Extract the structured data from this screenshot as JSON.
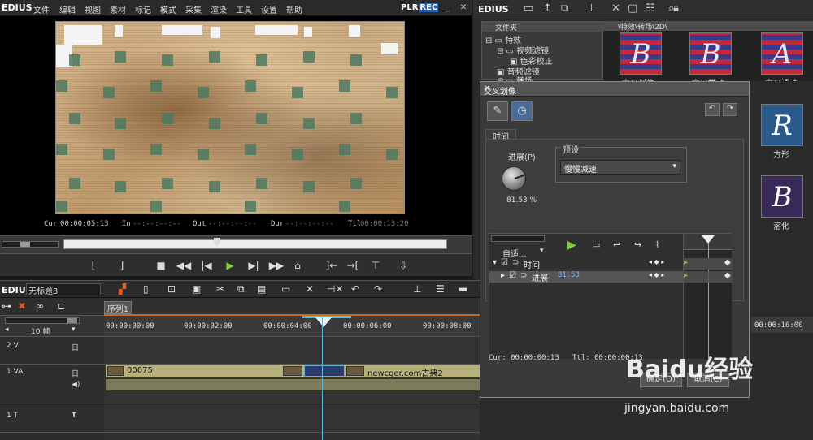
{
  "menu": {
    "logo": "EDIUS",
    "items": [
      "文件",
      "编辑",
      "视图",
      "素材",
      "标记",
      "模式",
      "采集",
      "渲染",
      "工具",
      "设置",
      "帮助"
    ],
    "plr": "PLR",
    "rec": "REC"
  },
  "timecodes": {
    "cur_label": "Cur",
    "cur": "00:00:05:13",
    "in_label": "In",
    "in": "--:--:--:--",
    "out_label": "Out",
    "out": "--:--:--:--",
    "dur_label": "Dur",
    "dur": "--:--:--:--",
    "ttl_label": "Ttl",
    "ttl": "00:00:13:20"
  },
  "bin": {
    "logo": "EDIUS",
    "tree_header": "文件夹",
    "path": "\\特效\\转场\\2D\\",
    "tree": [
      "特效",
      "视频滤镜",
      "色彩校正",
      "音频滤镜",
      "转场"
    ],
    "thumbs": [
      {
        "letter": "B",
        "label": "交叉划像"
      },
      {
        "letter": "B",
        "label": "交叉推动"
      },
      {
        "letter": "A",
        "label": "交叉滑动"
      },
      {
        "letter": "R",
        "label": "方形"
      },
      {
        "letter": "B",
        "label": "溶化"
      }
    ]
  },
  "dialog": {
    "title": "交叉划像",
    "tab": "时间",
    "progress_label": "进展(P)",
    "progress_value": "81.53 %",
    "preset_label": "预设",
    "preset_value": "慢慢减速",
    "auto_label": "自适...",
    "rows": [
      {
        "label": "时间"
      },
      {
        "label": "进展",
        "value": "81.53"
      }
    ],
    "cur_label": "Cur:",
    "cur": "00:00:00:13",
    "ttl_label": "Ttl:",
    "ttl": "00:00:00:13",
    "ok": "确定(O)",
    "cancel": "取消(C)"
  },
  "timeline": {
    "logo": "EDIUS",
    "project": "无标题3",
    "sequence_tab": "序列1",
    "zoom": "10 帧",
    "ruler": [
      "00:00:00:00",
      "00:00:02:00",
      "00:00:04:00",
      "00:00:06:00",
      "00:00:08:00"
    ],
    "ruler_right": "00:00:16:00",
    "tracks": [
      {
        "name": "2 V"
      },
      {
        "name": "1 VA"
      },
      {
        "name": "1 T"
      }
    ],
    "clip1": "00075",
    "clip2": "newcger.com古典2"
  },
  "watermark": {
    "text": "Baidu经验",
    "url": "jingyan.baidu.com"
  },
  "colors": {
    "play_green": "#7fcf3f",
    "playhead": "#5ab8d8",
    "rec_blue": "#2a5fb0",
    "clip_tan": "#b8b07a"
  }
}
